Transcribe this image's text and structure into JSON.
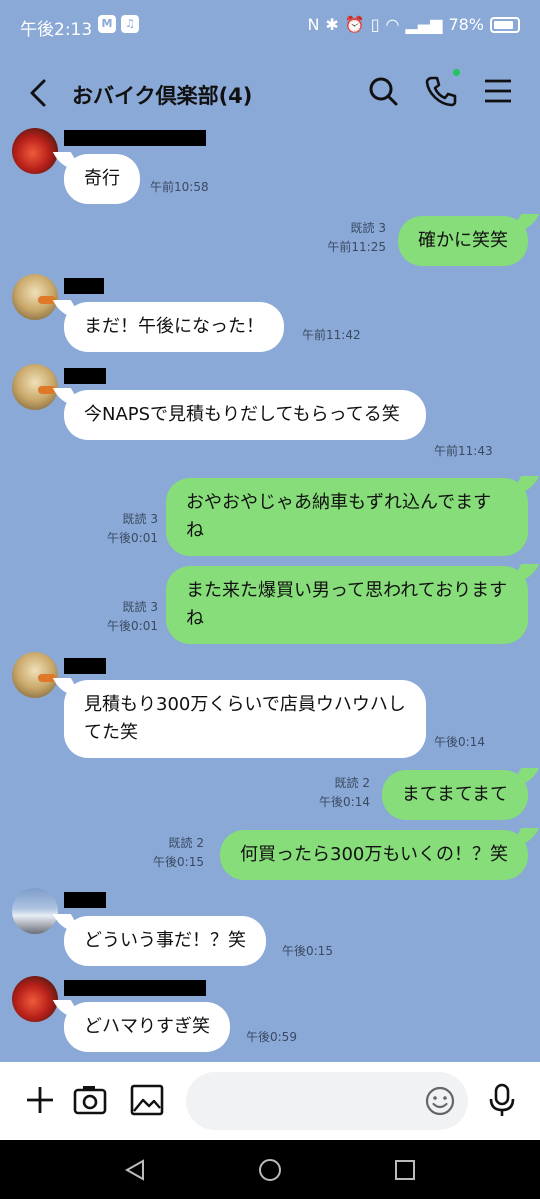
{
  "status": {
    "time": "午後2:13",
    "battery": "78%"
  },
  "header": {
    "title": "おバイク倶楽部(4)"
  },
  "messages": [
    {
      "dir": "in",
      "text": "奇行",
      "time": "午前10:58"
    },
    {
      "dir": "out",
      "text": "確かに笑笑",
      "read": "既読 3",
      "time": "午前11:25"
    },
    {
      "dir": "in",
      "text": "まだ！午後になった！",
      "time": "午前11:42"
    },
    {
      "dir": "in",
      "text": "今NAPSで見積もりだしてもらってる笑",
      "time": "午前11:43"
    },
    {
      "dir": "out",
      "text": "おやおやじゃあ納車もずれ込んでますね",
      "read": "既読 3",
      "time": "午後0:01"
    },
    {
      "dir": "out",
      "text": "また来た爆買い男って思われておりますね",
      "read": "既読 3",
      "time": "午後0:01"
    },
    {
      "dir": "in",
      "text": "見積もり300万くらいで店員ウハウハしてた笑",
      "time": "午後0:14"
    },
    {
      "dir": "out",
      "text": "まてまてまて",
      "read": "既読 2",
      "time": "午後0:14"
    },
    {
      "dir": "out",
      "text": "何買ったら300万もいくの！？笑",
      "read": "既読 2",
      "time": "午後0:15"
    },
    {
      "dir": "in",
      "text": "どういう事だ！？笑",
      "time": "午後0:15"
    },
    {
      "dir": "in",
      "text": "どハマりすぎ笑",
      "time": "午後0:59"
    }
  ],
  "icons": {
    "back": "back-chevron-icon",
    "search": "search-icon",
    "call": "phone-icon",
    "menu": "menu-icon",
    "add": "plus-icon",
    "camera": "camera-icon",
    "image": "image-icon",
    "emoji": "emoji-icon",
    "mic": "microphone-icon"
  },
  "colors": {
    "background": "#8aa9d6",
    "outgoing": "#86dd79",
    "incoming": "#ffffff"
  }
}
